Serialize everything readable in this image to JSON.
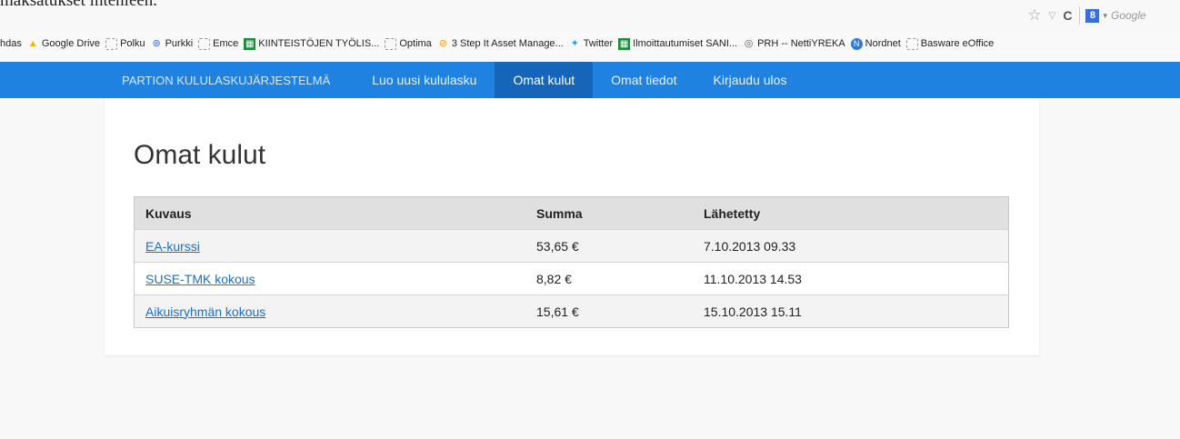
{
  "top_text": "maksatukset ihtenleen.",
  "browser": {
    "search_placeholder": "Google",
    "icons": [
      "star-icon",
      "dropdown-icon",
      "reload-icon",
      "google-plus-icon"
    ]
  },
  "bookmarks": [
    {
      "label": "hdas",
      "icon": "none"
    },
    {
      "label": "Google Drive",
      "icon": "drive-icon"
    },
    {
      "label": "Polku",
      "icon": "page-icon"
    },
    {
      "label": "Purkki",
      "icon": "purkki-icon"
    },
    {
      "label": "Emce",
      "icon": "page-icon"
    },
    {
      "label": "KIINTEISTÖJEN TYÖLIS...",
      "icon": "sheet-icon"
    },
    {
      "label": "Optima",
      "icon": "page-icon"
    },
    {
      "label": "3 Step It Asset Manage...",
      "icon": "optima-icon"
    },
    {
      "label": "Twitter",
      "icon": "twitter-icon"
    },
    {
      "label": "Ilmoittautumiset SANI...",
      "icon": "sheet-icon"
    },
    {
      "label": "PRH -- NettiYREKA",
      "icon": "prh-icon"
    },
    {
      "label": "Nordnet",
      "icon": "nordnet-icon"
    },
    {
      "label": "Basware eOffice",
      "icon": "page-icon"
    }
  ],
  "nav": {
    "brand": "PARTION KULULASKUJÄRJESTELMÄ",
    "items": [
      {
        "label": "Luo uusi kululasku",
        "active": false
      },
      {
        "label": "Omat kulut",
        "active": true
      },
      {
        "label": "Omat tiedot",
        "active": false
      },
      {
        "label": "Kirjaudu ulos",
        "active": false
      }
    ]
  },
  "page_title": "Omat kulut",
  "table": {
    "headers": [
      "Kuvaus",
      "Summa",
      "Lähetetty"
    ],
    "rows": [
      {
        "kuvaus": "EA-kurssi",
        "summa": "53,65 €",
        "lahetetty": "7.10.2013 09.33"
      },
      {
        "kuvaus": "SUSE-TMK kokous",
        "summa": "8,82 €",
        "lahetetty": "11.10.2013 14.53"
      },
      {
        "kuvaus": "Aikuisryhmän kokous",
        "summa": "15,61 €",
        "lahetetty": "15.10.2013 15.11"
      }
    ]
  },
  "colors": {
    "navbar": "#1f82e0",
    "nav_active": "#1566b8",
    "link": "#1a6fc8"
  }
}
